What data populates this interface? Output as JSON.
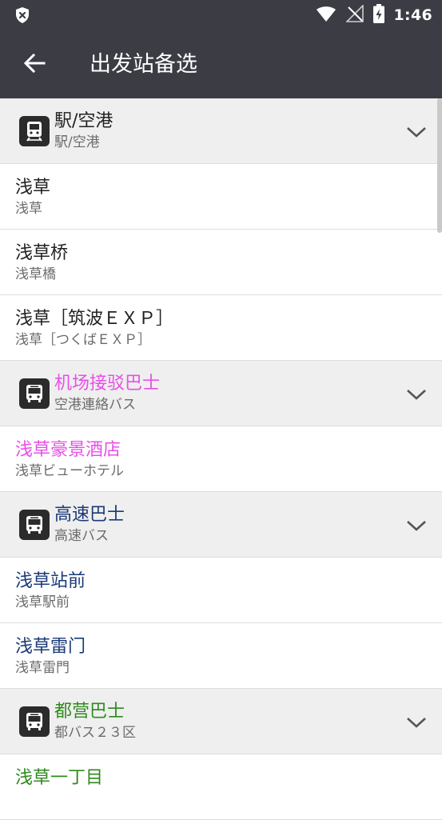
{
  "status_bar": {
    "time": "1:46",
    "icons": [
      "shield-x-icon",
      "wifi-icon",
      "signal-off-icon",
      "battery-charging-icon"
    ]
  },
  "app_bar": {
    "title": "出发站备选",
    "back_icon": "arrow-left-icon"
  },
  "colors": {
    "bar_bg": "#3c3c45",
    "header_bg": "#efefef",
    "train": "#222222",
    "airport_bus": "#e84fe8",
    "highway_bus": "#1a3a78",
    "metro_bus": "#2f8a1e"
  },
  "groups": [
    {
      "id": "train",
      "icon": "train-icon",
      "title": "駅/空港",
      "subtitle": "駅/空港",
      "color": "#222222",
      "items": [
        {
          "title": "浅草",
          "subtitle": "浅草"
        },
        {
          "title": "浅草桥",
          "subtitle": "浅草橋"
        },
        {
          "title": "浅草［筑波ＥＸＰ］",
          "subtitle": "浅草［つくばＥＸＰ］"
        }
      ]
    },
    {
      "id": "airport_bus",
      "icon": "bus-icon",
      "title": "机场接驳巴士",
      "subtitle": "空港連絡バス",
      "color": "#e84fe8",
      "items": [
        {
          "title": "浅草豪景酒店",
          "subtitle": "浅草ビューホテル"
        }
      ]
    },
    {
      "id": "highway_bus",
      "icon": "bus-icon",
      "title": "高速巴士",
      "subtitle": "高速バス",
      "color": "#1a3a78",
      "items": [
        {
          "title": "浅草站前",
          "subtitle": "浅草駅前"
        },
        {
          "title": "浅草雷门",
          "subtitle": "浅草雷門"
        }
      ]
    },
    {
      "id": "metro_bus",
      "icon": "bus-icon",
      "title": "都营巴士",
      "subtitle": "都バス２３区",
      "color": "#2f8a1e",
      "items": [
        {
          "title": "浅草一丁目",
          "subtitle": ""
        }
      ]
    }
  ]
}
